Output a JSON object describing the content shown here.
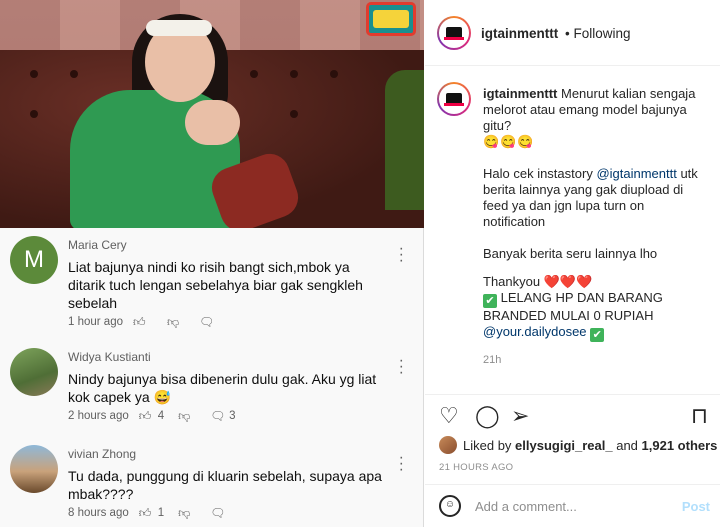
{
  "video": {
    "logo_text": "",
    "colors": {
      "sofa": "#4a2a23",
      "sweater": "#2f9a52"
    }
  },
  "comments": [
    {
      "author": "Maria Cery",
      "avatar_letter": "M",
      "text": "Liat bajunya nindi ko risih bangt sich,mbok ya ditarik tuch lengan sebelahya biar gak sengkleh sebelah",
      "time": "1 hour ago",
      "likes": "",
      "replies": ""
    },
    {
      "author": "Widya Kustianti",
      "text": "Nindy bajunya bisa dibenerin dulu gak. Aku yg liat kok capek ya 😅",
      "time": "2 hours ago",
      "likes": "4",
      "replies": "3"
    },
    {
      "author": "vivian Zhong",
      "text": "Tu dada, punggung di kluarin sebelah, supaya apa mbak????",
      "time": "8 hours ago",
      "likes": "1",
      "replies": ""
    }
  ],
  "instagram": {
    "username": "igtainmenttt",
    "follow_status": "• Following",
    "caption_user": "igtainmenttt",
    "caption_line1": " Menurut kalian sengaja melorot atau emang model bajunya gitu?",
    "caption_emojis": "😋😋😋",
    "para2_prefix": "Halo cek instastory ",
    "para2_mention": "@igtainmenttt",
    "para2_suffix": " utk berita lainnya yang gak diupload di feed ya dan jgn lupa turn on notification",
    "para3": "Banyak berita seru lainnya lho",
    "thanks": "Thankyou ",
    "hearts": "❤️❤️❤️",
    "lelang": " LELANG HP DAN BARANG BRANDED MULAI 0 RUPIAH",
    "lelang_mention": "@your.dailydosee",
    "time_ago": "21h",
    "likes_prefix": "Liked by ",
    "likes_user": "ellysugigi_real_",
    "likes_and": " and ",
    "likes_count": "1,921 others",
    "posted": "21 HOURS AGO",
    "comment_placeholder": "Add a comment...",
    "post_label": "Post"
  },
  "icons": {
    "like": "thumb-up-icon",
    "dislike": "thumb-down-icon",
    "reply": "comment-icon",
    "heart": "heart-icon",
    "chat": "chat-bubble-icon",
    "share": "paper-plane-icon",
    "save": "bookmark-icon"
  }
}
